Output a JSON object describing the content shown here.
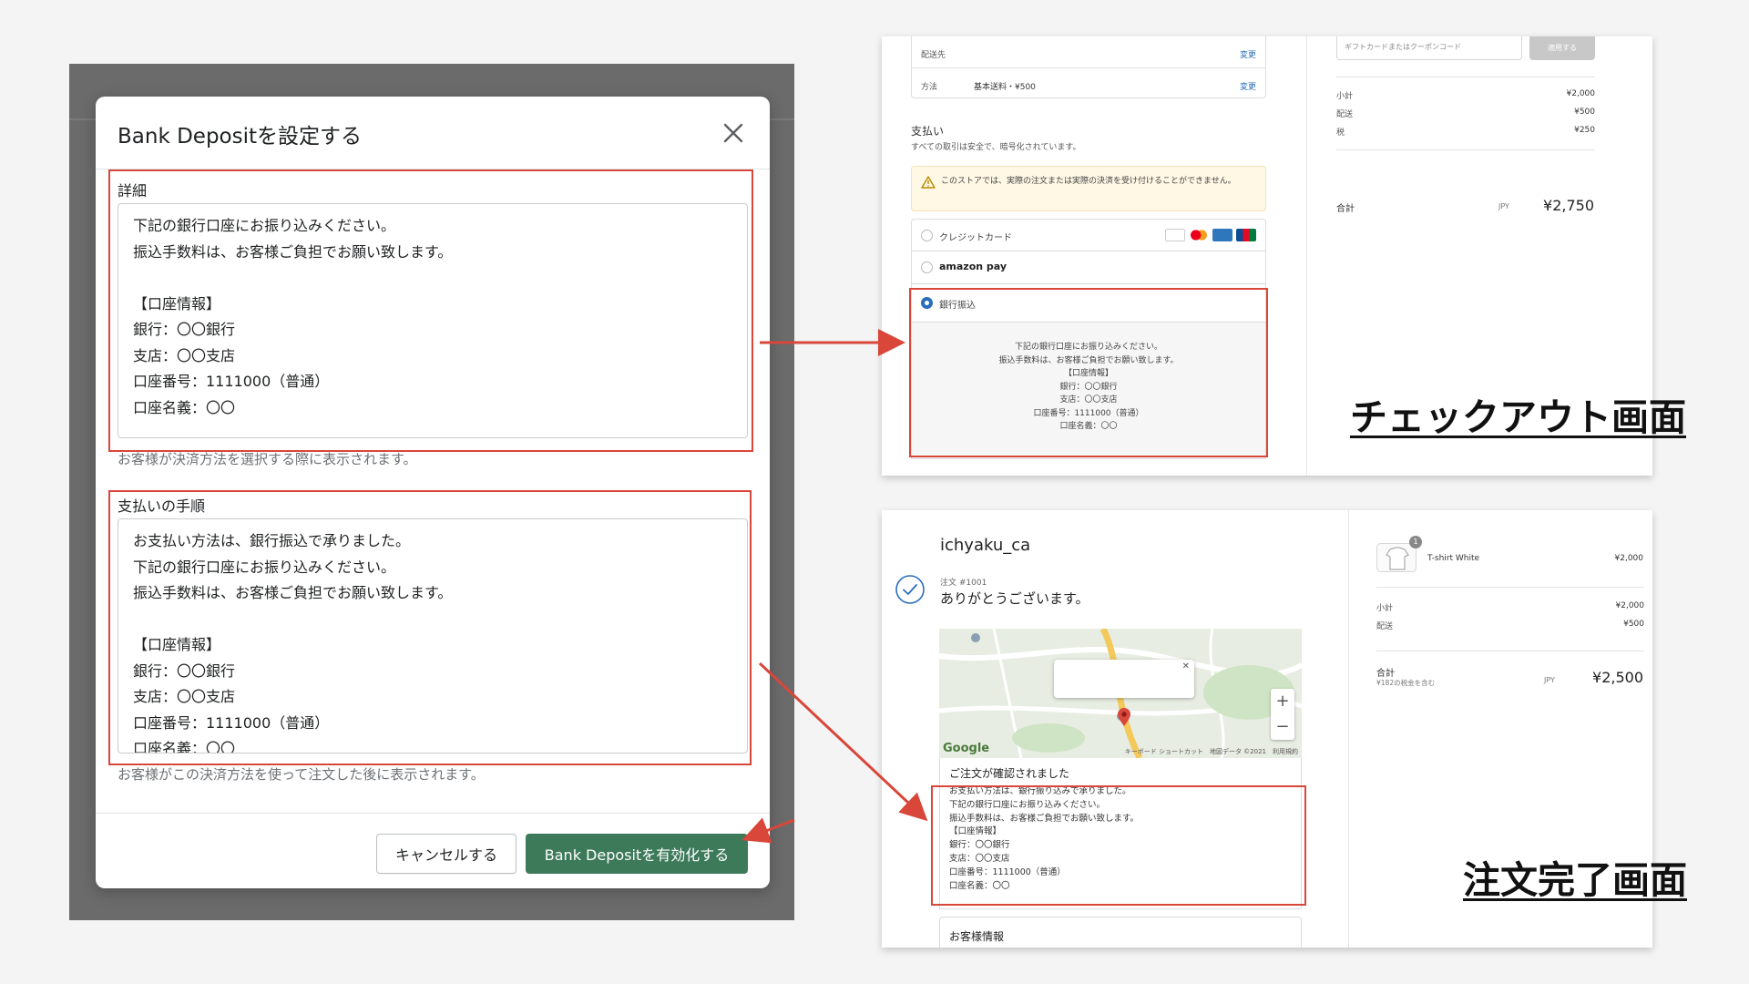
{
  "modal": {
    "title": "Bank Depositを設定する",
    "details_label": "詳細",
    "details_lines": [
      "下記の銀行口座にお振り込みください。",
      "振込手数料は、お客様ご負担でお願い致します。",
      "",
      "【口座情報】",
      "銀行：〇〇銀行",
      "支店：〇〇支店",
      "口座番号：1111000（普通）",
      "口座名義：〇〇"
    ],
    "details_help": "お客様が決済方法を選択する際に表示されます。",
    "instructions_label": "支払いの手順",
    "instructions_lines": [
      "お支払い方法は、銀行振込で承りました。",
      "下記の銀行口座にお振り込みください。",
      "振込手数料は、お客様ご負担でお願い致します。",
      "",
      "【口座情報】",
      "銀行：〇〇銀行",
      "支店：〇〇支店",
      "口座番号：1111000（普通）",
      "口座名義：〇〇"
    ],
    "instructions_help": "お客様がこの決済方法を使って注文した後に表示されます。",
    "cancel_label": "キャンセルする",
    "activate_label": "Bank Depositを有効化する"
  },
  "checkout": {
    "ship_to_label": "配送先",
    "method_label": "方法",
    "method_value": "基本送料・¥500",
    "change_label": "変更",
    "payment_title": "支払い",
    "payment_subtitle": "すべての取引は安全で、暗号化されています。",
    "warning": "このストアでは、実際の注文または実際の決済を受け付けることができません。",
    "credit_card_label": "クレジットカード",
    "amazon_pay_label": "amazon pay",
    "bank_transfer_label": "銀行振込",
    "bank_detail_lines": [
      "下記の銀行口座にお振り込みください。",
      "振込手数料は、お客様ご負担でお願い致します。",
      "【口座情報】",
      "銀行：〇〇銀行",
      "支店：〇〇支店",
      "口座番号：1111000（普通）",
      "口座名義：〇〇"
    ],
    "gift_placeholder": "ギフトカードまたはクーポンコード",
    "apply_label": "適用する",
    "subtotal_label": "小計",
    "subtotal": "¥2,000",
    "shipping_label": "配送",
    "shipping": "¥500",
    "tax_label": "税",
    "tax": "¥250",
    "total_label": "合計",
    "currency": "JPY",
    "total": "¥2,750"
  },
  "order": {
    "shop_name": "ichyaku_ca",
    "order_number": "注文 #1001",
    "thanks": "ありがとうございます。",
    "map_attribution": "キーボード ショートカット　地図データ ©2021　利用規約",
    "confirm_title": "ご注文が確認されました",
    "confirm_lines": [
      "お支払い方法は、銀行振り込みで承りました。",
      "下記の銀行口座にお振り込みください。",
      "振込手数料は、お客様ご負担でお願い致します。",
      "【口座情報】",
      "銀行：〇〇銀行",
      "支店：〇〇支店",
      "口座番号：1111000（普通）",
      "口座名義：〇〇"
    ],
    "customer_info_title": "お客様情報",
    "item_quantity": "1",
    "item_name": "T-shirt White",
    "item_price": "¥2,000",
    "subtotal_label": "小計",
    "subtotal": "¥2,000",
    "shipping_label": "配送",
    "shipping": "¥500",
    "total_label": "合計",
    "tax_note": "¥182の税金を含む",
    "currency": "JPY",
    "total": "¥2,500"
  },
  "captions": {
    "checkout": "チェックアウト画面",
    "order_complete": "注文完了画面"
  },
  "colors": {
    "highlight": "#d9463a",
    "primary_button": "#3d7a5a",
    "link": "#2a6ebb"
  }
}
